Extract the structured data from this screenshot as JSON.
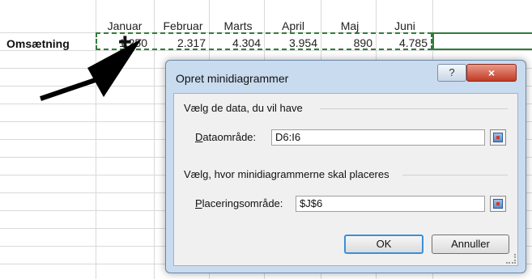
{
  "sheet": {
    "months": [
      "Januar",
      "Februar",
      "Marts",
      "April",
      "Maj",
      "Juni"
    ],
    "row_label": "Omsætning",
    "values": [
      "1.250",
      "2.317",
      "4.304",
      "3.954",
      "890",
      "4.785"
    ]
  },
  "dialog": {
    "title": "Opret minidiagrammer",
    "help_label": "?",
    "close_label": "×",
    "group_data_label": "Vælg de data, du vil have",
    "data_range_label": "Dataområde:",
    "data_range_key": "D",
    "data_range_value": "D6:I6",
    "group_location_label": "Vælg, hvor minidiagrammerne skal placeres",
    "location_range_label": "Placeringsområde:",
    "location_range_key": "P",
    "location_range_value": "$J$6",
    "ok_label": "OK",
    "cancel_label": "Annuller"
  }
}
